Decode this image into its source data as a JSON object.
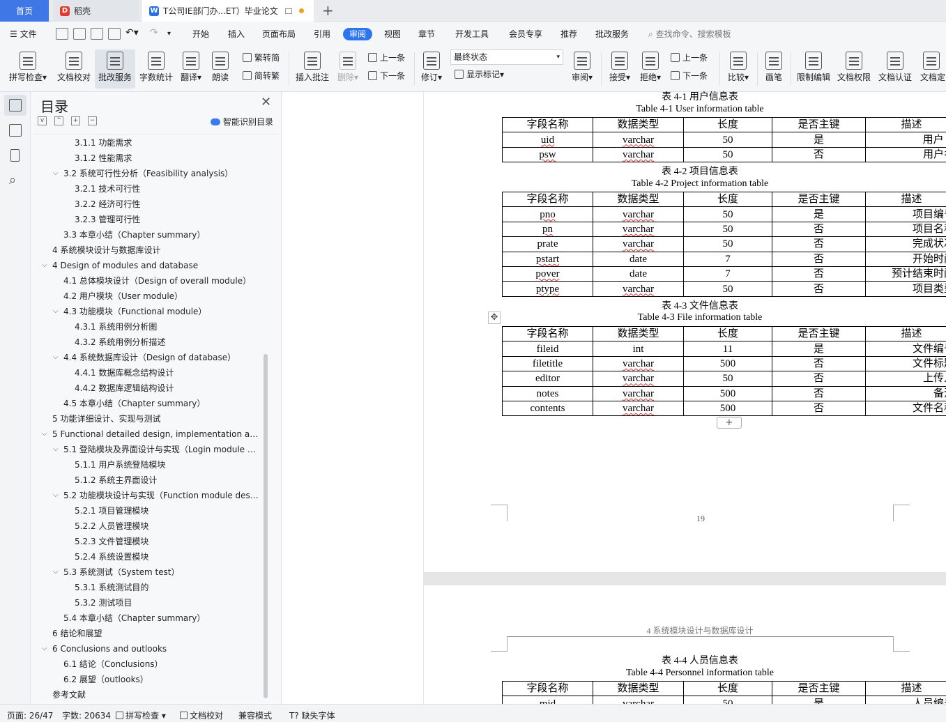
{
  "tabs": {
    "home": "首页",
    "daoke": "稻壳",
    "doc": "T公司IE部门办...ET）毕业论文"
  },
  "menu": {
    "file": "文件",
    "items": [
      "开始",
      "插入",
      "页面布局",
      "引用",
      "审阅",
      "视图",
      "章节",
      "开发工具",
      "会员专享",
      "推荐",
      "批改服务"
    ],
    "search": "查找命令、搜索模板"
  },
  "ribbon": {
    "spellcheck": "拼写检查",
    "proofread": "文档校对",
    "correction": "批改服务",
    "wordcount": "字数统计",
    "translate": "翻译",
    "read": "朗读",
    "to_trad": "繁转简",
    "to_simp": "简转繁",
    "insert_comment": "插入批注",
    "delete": "删除",
    "prev": "上一条",
    "next": "下一条",
    "revise": "修订",
    "final_state": "最终状态",
    "show_marks": "显示标记",
    "review": "审阅",
    "accept": "接受",
    "reject": "拒绝",
    "prev2": "上一条",
    "next2": "下一条",
    "compare": "比较",
    "pen": "画笔",
    "restrict": "限制编辑",
    "permission": "文档权限",
    "certify": "文档认证",
    "finalize": "文档定"
  },
  "toc": {
    "title": "目录",
    "smart": "智能识别目录",
    "items": [
      {
        "text": "3.1.1  功能需求",
        "level": 3,
        "chev": ""
      },
      {
        "text": "3.1.2  性能需求",
        "level": 3,
        "chev": ""
      },
      {
        "text": "3.2  系统可行性分析（Feasibility analysis）",
        "level": 2,
        "chev": "v"
      },
      {
        "text": "3.2.1  技术可行性",
        "level": 3,
        "chev": ""
      },
      {
        "text": "3.2.2  经济可行性",
        "level": 3,
        "chev": ""
      },
      {
        "text": "3.2.3 管理可行性",
        "level": 3,
        "chev": ""
      },
      {
        "text": "3.3 本章小结（Chapter summary）",
        "level": 2,
        "chev": ""
      },
      {
        "text": "4 系统模块设计与数据库设计",
        "level": 1,
        "chev": ""
      },
      {
        "text": "4 Design of modules and database",
        "level": 1,
        "chev": "v"
      },
      {
        "text": "4.1 总体模块设计（Design of overall module）",
        "level": 2,
        "chev": ""
      },
      {
        "text": "4.2  用户模块（User module）",
        "level": 2,
        "chev": ""
      },
      {
        "text": "4.3  功能模块（Functional module）",
        "level": 2,
        "chev": "v"
      },
      {
        "text": "4.3.1  系统用例分析图",
        "level": 3,
        "chev": ""
      },
      {
        "text": "4.3.2 系统用例分析描述",
        "level": 3,
        "chev": ""
      },
      {
        "text": "4.4 系统数据库设计（Design of database）",
        "level": 2,
        "chev": "v"
      },
      {
        "text": "4.4.1 数据库概念结构设计",
        "level": 3,
        "chev": ""
      },
      {
        "text": "4.4.2 数据库逻辑结构设计",
        "level": 3,
        "chev": ""
      },
      {
        "text": "4.5 本章小结（Chapter summary）",
        "level": 2,
        "chev": ""
      },
      {
        "text": "5 功能详细设计、实现与测试",
        "level": 1,
        "chev": ""
      },
      {
        "text": "5 Functional detailed design, implementation an…",
        "level": 1,
        "chev": "v"
      },
      {
        "text": "5.1 登陆模块及界面设计与实现（Login module a…",
        "level": 2,
        "chev": "v"
      },
      {
        "text": "5.1.1  用户系统登陆模块",
        "level": 3,
        "chev": ""
      },
      {
        "text": "5.1.2 系统主界面设计",
        "level": 3,
        "chev": ""
      },
      {
        "text": "5.2 功能模块设计与实现（Function module desi…",
        "level": 2,
        "chev": "v"
      },
      {
        "text": "5.2.1  项目管理模块",
        "level": 3,
        "chev": ""
      },
      {
        "text": "5.2.2 人员管理模块",
        "level": 3,
        "chev": ""
      },
      {
        "text": "5.2.3 文件管理模块",
        "level": 3,
        "chev": ""
      },
      {
        "text": "5.2.4 系统设置模块",
        "level": 3,
        "chev": ""
      },
      {
        "text": "5.3  系统测试（System test）",
        "level": 2,
        "chev": "v"
      },
      {
        "text": "5.3.1 系统测试目的",
        "level": 3,
        "chev": ""
      },
      {
        "text": "5.3.2 测试项目",
        "level": 3,
        "chev": ""
      },
      {
        "text": "5.4 本章小结（Chapter summary）",
        "level": 2,
        "chev": ""
      },
      {
        "text": "6 结论和展望",
        "level": 1,
        "chev": ""
      },
      {
        "text": "6 Conclusions and outlooks",
        "level": 1,
        "chev": "v"
      },
      {
        "text": "6.1 结论（Conclusions）",
        "level": 2,
        "chev": ""
      },
      {
        "text": "6.2  展望（outlooks）",
        "level": 2,
        "chev": ""
      },
      {
        "text": "参考文献",
        "level": 1,
        "chev": ""
      }
    ]
  },
  "doc": {
    "headers": [
      "字段名称",
      "数据类型",
      "长度",
      "是否主键",
      "描述"
    ],
    "t1": {
      "cap_cn": "表 4-1  用户信息表",
      "cap_en": "Table 4-1 User information table",
      "rows": [
        [
          "uid",
          "varchar",
          "50",
          "是",
          "用户 id"
        ],
        [
          "psw",
          "varchar",
          "50",
          "否",
          "用户名"
        ]
      ]
    },
    "t2": {
      "cap_cn": "表 4-2 项目信息表",
      "cap_en": "Table 4-2 Project information table",
      "rows": [
        [
          "pno",
          "varchar",
          "50",
          "是",
          "项目编号"
        ],
        [
          "pn",
          "varchar",
          "50",
          "否",
          "项目名称"
        ],
        [
          "prate",
          "varchar",
          "50",
          "否",
          "完成状况"
        ],
        [
          "pstart",
          "date",
          "7",
          "否",
          "开始时间"
        ],
        [
          "pover",
          "date",
          "7",
          "否",
          "预计结束时间"
        ],
        [
          "ptype",
          "varchar",
          "50",
          "否",
          "项目类型"
        ]
      ]
    },
    "t3": {
      "cap_cn": "表 4-3 文件信息表",
      "cap_en": "Table 4-3 File information table",
      "rows": [
        [
          "fileid",
          "int",
          "11",
          "是",
          "文件编号"
        ],
        [
          "filetitle",
          "varchar",
          "500",
          "否",
          "文件标题"
        ],
        [
          "editor",
          "varchar",
          "50",
          "否",
          "上传人"
        ],
        [
          "notes",
          "varchar",
          "500",
          "否",
          "备注"
        ],
        [
          "contents",
          "varchar",
          "500",
          "否",
          "文件名称"
        ]
      ]
    },
    "page_number": "19",
    "page2_header": "4 系统模块设计与数据库设计",
    "t4": {
      "cap_cn": "表 4-4 人员信息表",
      "cap_en": "Table 4-4 Personnel information table",
      "rows": [
        [
          "mid",
          "varchar",
          "50",
          "是",
          "人员编号"
        ]
      ]
    },
    "plus": "+"
  },
  "status": {
    "page": "页面: 26/47",
    "words": "字数: 20634",
    "spell": "拼写检查",
    "proof": "文档校对",
    "compat": "兼容模式",
    "missing_font": "缺失字体"
  }
}
